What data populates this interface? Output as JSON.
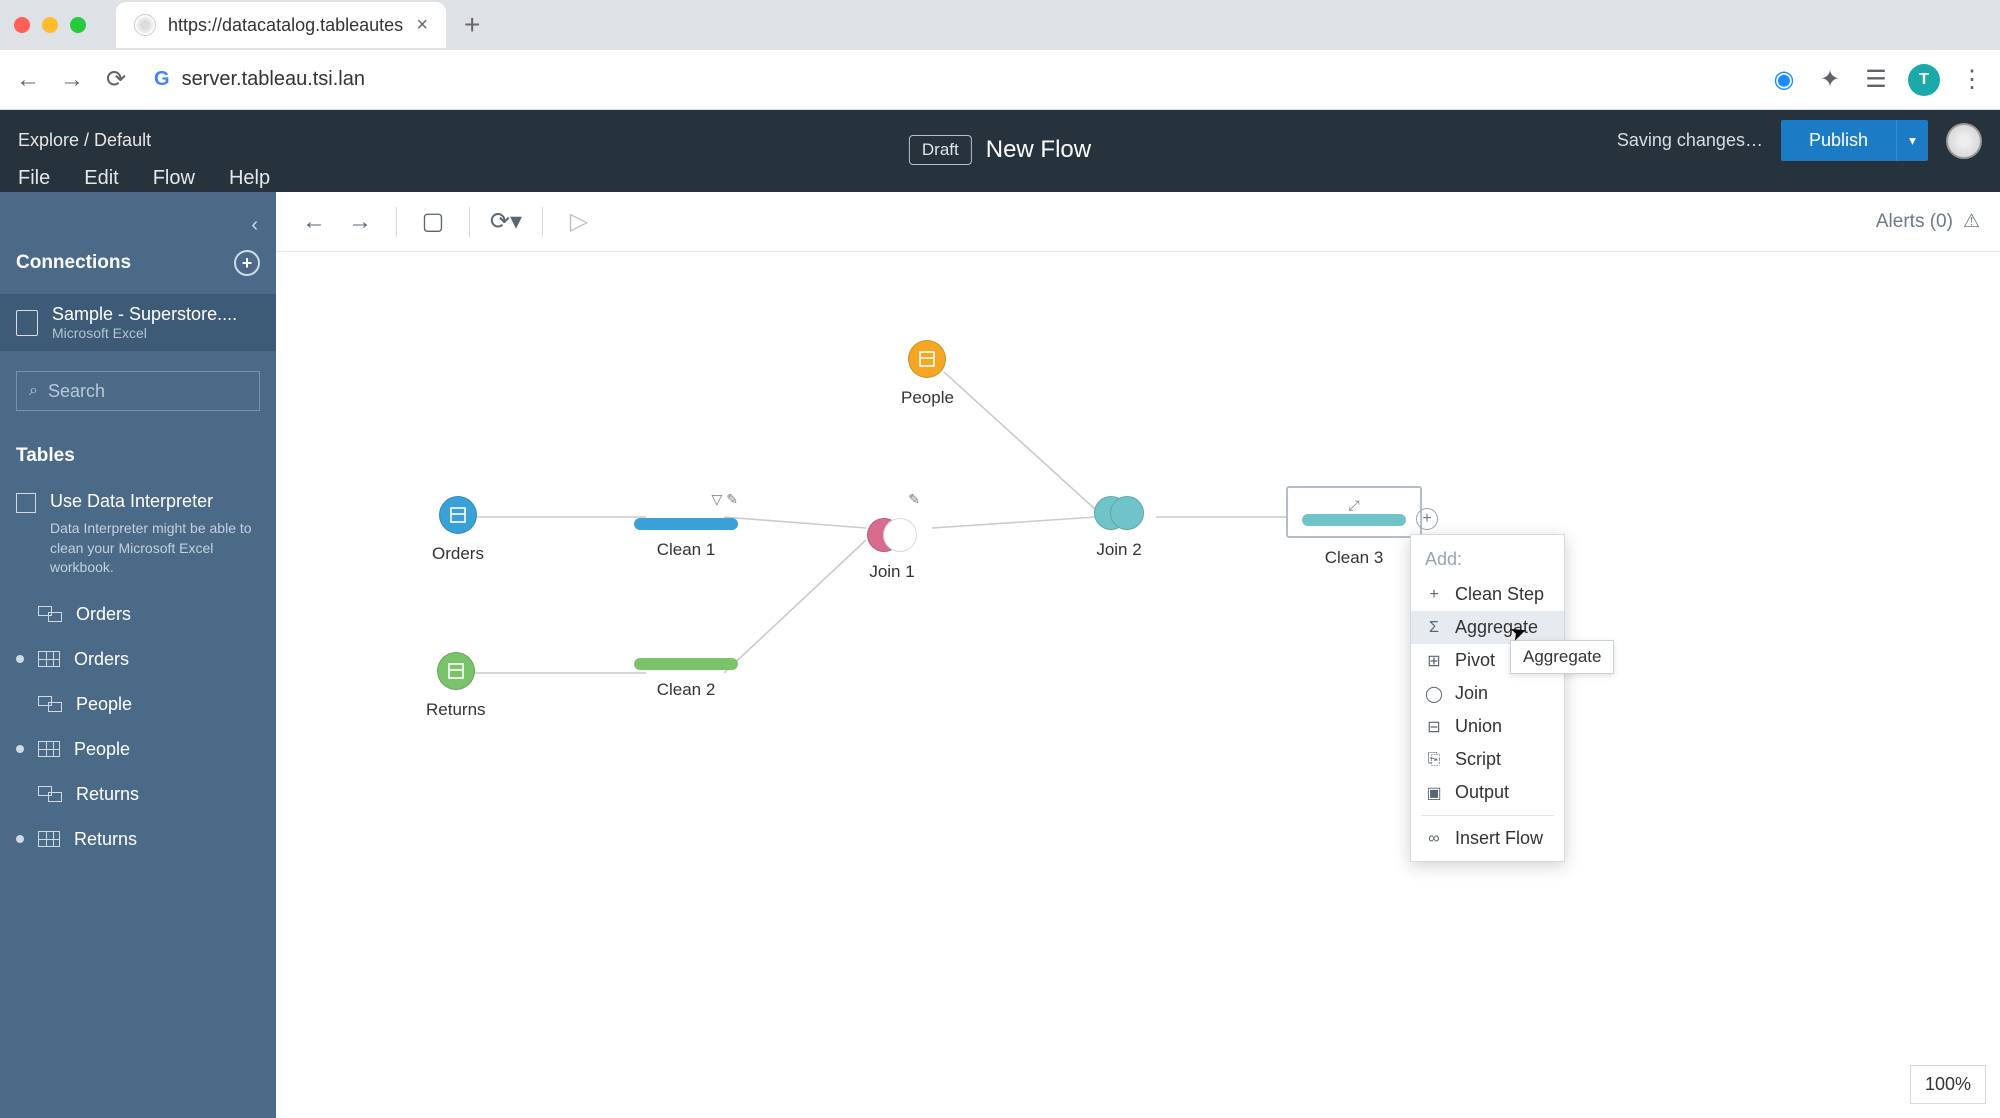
{
  "browser": {
    "tab_title": "https://datacatalog.tableautes",
    "url": "server.tableau.tsi.lan"
  },
  "header": {
    "breadcrumb_root": "Explore",
    "breadcrumb_sep": " / ",
    "breadcrumb_current": "Default",
    "draft_badge": "Draft",
    "flow_title": "New Flow",
    "saving_text": "Saving changes…",
    "publish_label": "Publish"
  },
  "menu": {
    "file": "File",
    "edit": "Edit",
    "flow": "Flow",
    "help": "Help"
  },
  "sidebar": {
    "connections_header": "Connections",
    "connection": {
      "name": "Sample - Superstore....",
      "type": "Microsoft Excel"
    },
    "search_placeholder": "Search",
    "tables_header": "Tables",
    "data_interpreter_label": "Use Data Interpreter",
    "data_interpreter_desc": "Data Interpreter might be able to clean your Microsoft Excel workbook.",
    "tables": [
      {
        "name": "Orders",
        "type": "rel"
      },
      {
        "name": "Orders",
        "type": "grid",
        "bullet": true
      },
      {
        "name": "People",
        "type": "rel"
      },
      {
        "name": "People",
        "type": "grid",
        "bullet": true
      },
      {
        "name": "Returns",
        "type": "rel"
      },
      {
        "name": "Returns",
        "type": "grid",
        "bullet": true
      }
    ]
  },
  "toolbar": {
    "alerts_label": "Alerts (0)"
  },
  "nodes": {
    "orders": "Orders",
    "returns": "Returns",
    "people": "People",
    "clean1": "Clean 1",
    "clean2": "Clean 2",
    "join1": "Join 1",
    "join2": "Join 2",
    "clean3": "Clean 3"
  },
  "context_menu": {
    "heading": "Add:",
    "items": {
      "clean_step": "Clean Step",
      "aggregate": "Aggregate",
      "pivot": "Pivot",
      "join": "Join",
      "union": "Union",
      "script": "Script",
      "output": "Output",
      "insert_flow": "Insert Flow"
    },
    "tooltip": "Aggregate"
  },
  "zoom": "100%",
  "colors": {
    "blue_node": "#3aa1d8",
    "orange_node": "#f5a623",
    "green_node": "#7ac36a",
    "teal_node": "#6fc3c9",
    "pink_node": "#d96b8e"
  }
}
